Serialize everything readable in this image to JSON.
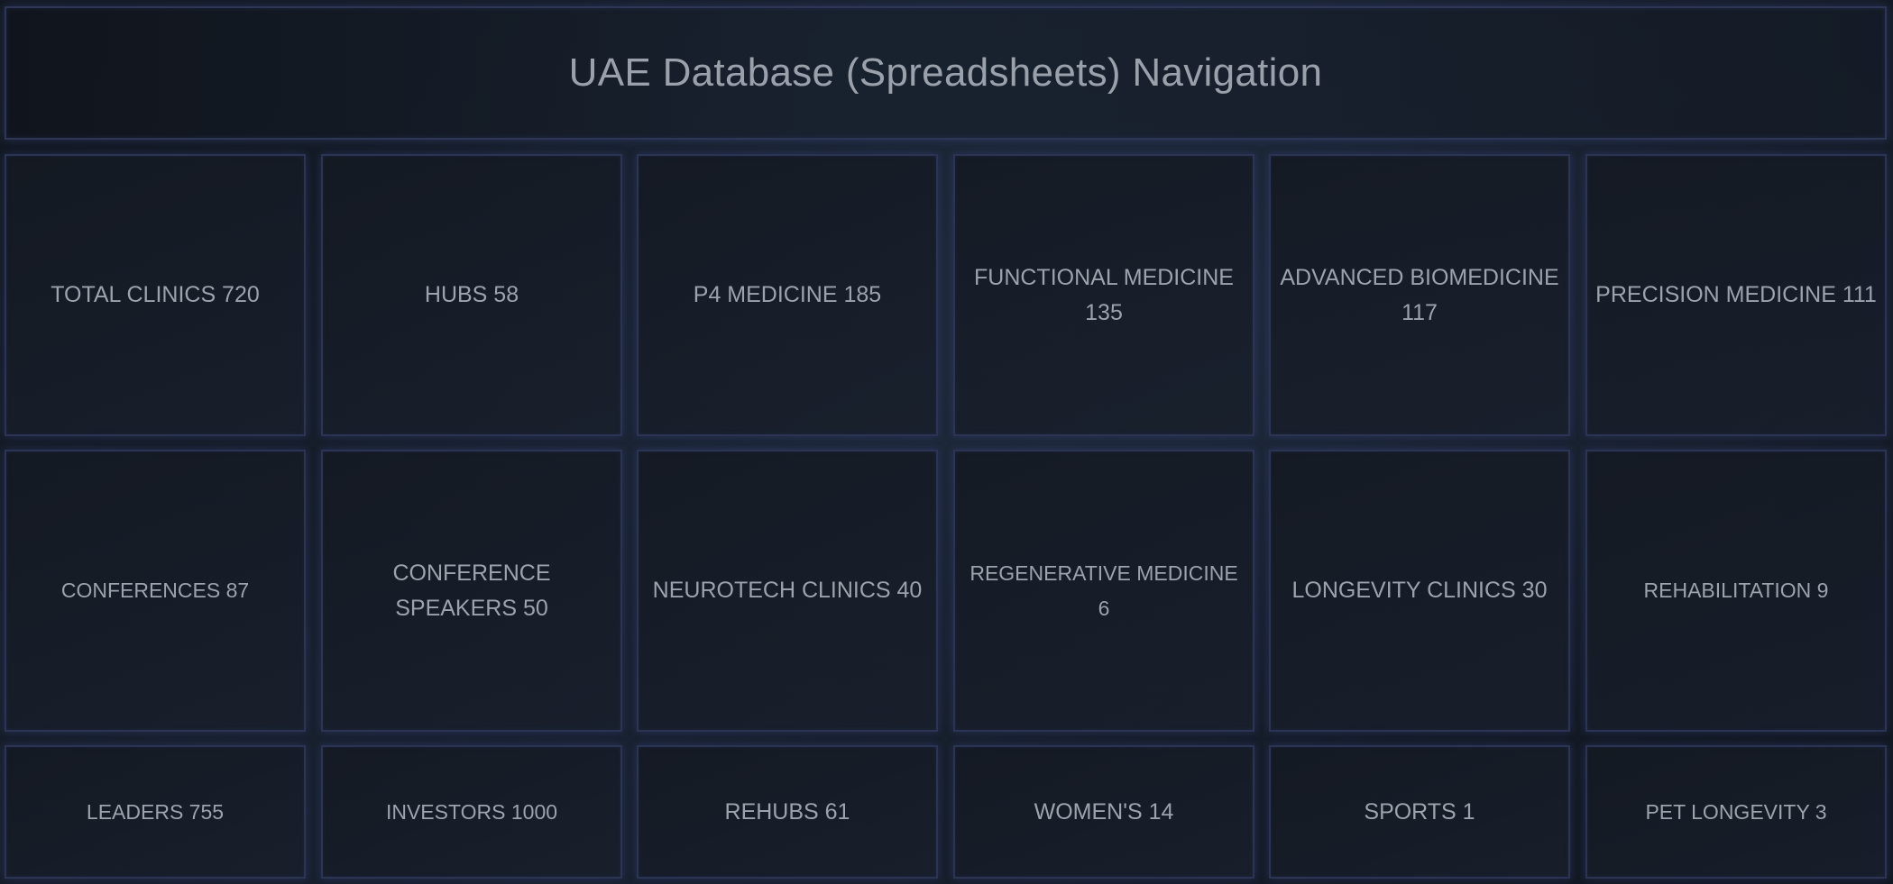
{
  "header": {
    "title": "UAE Database (Spreadsheets) Navigation"
  },
  "tiles": [
    {
      "label": "TOTAL CLINICS 720"
    },
    {
      "label": "HUBS 58"
    },
    {
      "label": "P4 MEDICINE 185"
    },
    {
      "label": "FUNCTIONAL MEDICINE 135"
    },
    {
      "label": "ADVANCED BIOMEDICINE 117"
    },
    {
      "label": "PRECISION MEDICINE 111"
    },
    {
      "label": "CONFERENCES 87"
    },
    {
      "label": "CONFERENCE SPEAKERS 50"
    },
    {
      "label": "NEUROTECH CLINICS 40"
    },
    {
      "label": "REGENERATIVE MEDICINE 6"
    },
    {
      "label": "LONGEVITY CLINICS 30"
    },
    {
      "label": "REHABILITATION 9"
    },
    {
      "label": "LEADERS 755"
    },
    {
      "label": "INVESTORS 1000"
    },
    {
      "label": "REHUBS 61"
    },
    {
      "label": "WOMEN'S 14"
    },
    {
      "label": "SPORTS 1"
    },
    {
      "label": "PET LONGEVITY 3"
    }
  ],
  "colors": {
    "background": "#121822",
    "border_glow": "#2e3656",
    "text": "#9ca3ad"
  }
}
